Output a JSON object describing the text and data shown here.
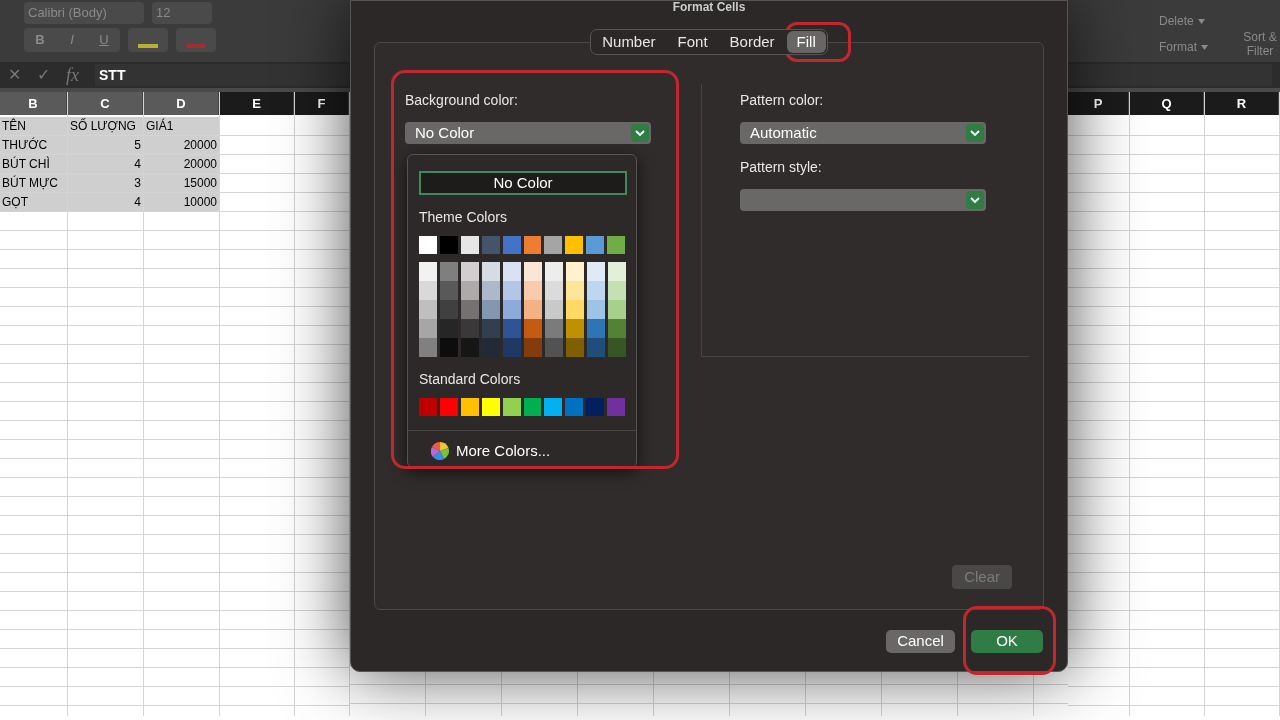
{
  "ribbon": {
    "font_name": "Calibri (Body)",
    "font_size": "12",
    "style_buttons": [
      "B",
      "I",
      "U"
    ],
    "cells_buttons": [
      "Delete",
      "Format"
    ],
    "sort_filter": "Sort & Filter"
  },
  "formula_bar": {
    "cancel": "✕",
    "enter": "✓",
    "fx": "fx",
    "value": "STT"
  },
  "columns_left": [
    {
      "label": "B",
      "selected": true
    },
    {
      "label": "C",
      "selected": true
    },
    {
      "label": "D",
      "selected": true
    },
    {
      "label": "E",
      "selected": false
    },
    {
      "label": "F",
      "selected": false
    }
  ],
  "columns_right": [
    {
      "label": "P",
      "selected": false
    },
    {
      "label": "Q",
      "selected": false
    },
    {
      "label": "R",
      "selected": false
    }
  ],
  "rows": [
    {
      "cells": [
        "TÊN",
        "SỐ LƯỢNG",
        "GIÁ1"
      ]
    },
    {
      "cells": [
        "THƯỚC",
        "5",
        "20000"
      ]
    },
    {
      "cells": [
        "BÚT CHÌ",
        "4",
        "20000"
      ]
    },
    {
      "cells": [
        "BÚT MỰC",
        "3",
        "15000"
      ]
    },
    {
      "cells": [
        "GỌT",
        "4",
        "10000"
      ]
    }
  ],
  "dialog": {
    "title": "Format Cells",
    "tabs": [
      {
        "label": "Number",
        "selected": false
      },
      {
        "label": "Font",
        "selected": false
      },
      {
        "label": "Border",
        "selected": false
      },
      {
        "label": "Fill",
        "selected": true
      }
    ],
    "background_color": {
      "label": "Background color:",
      "value": "No Color",
      "expanded": true
    },
    "pattern_color": {
      "label": "Pattern color:",
      "value": "Automatic"
    },
    "pattern_style": {
      "label": "Pattern style:"
    },
    "popup": {
      "no_color": "No Color",
      "theme_title": "Theme Colors",
      "theme_colors": [
        {
          "color": "#ffffff",
          "shades": [
            {
              "color": "#f2f2f2"
            },
            {
              "color": "#d9d9d9"
            },
            {
              "color": "#bfbfbf"
            },
            {
              "color": "#a6a6a6"
            },
            {
              "color": "#808080"
            }
          ]
        },
        {
          "color": "#000000",
          "shades": [
            {
              "color": "#7f7f7f"
            },
            {
              "color": "#595959"
            },
            {
              "color": "#404040"
            },
            {
              "color": "#262626"
            },
            {
              "color": "#0d0d0d"
            }
          ]
        },
        {
          "color": "#e7e6e6",
          "shades": [
            {
              "color": "#d0cece"
            },
            {
              "color": "#aeaaaa"
            },
            {
              "color": "#757171"
            },
            {
              "color": "#3a3838"
            },
            {
              "color": "#171616"
            }
          ]
        },
        {
          "color": "#44546a",
          "shades": [
            {
              "color": "#d6dce4"
            },
            {
              "color": "#adb9ca"
            },
            {
              "color": "#8497b0"
            },
            {
              "color": "#333f4f"
            },
            {
              "color": "#222a35"
            }
          ]
        },
        {
          "color": "#4472c4",
          "shades": [
            {
              "color": "#d9e2f3"
            },
            {
              "color": "#b4c6e7"
            },
            {
              "color": "#8eaadb"
            },
            {
              "color": "#2f5496"
            },
            {
              "color": "#1f3864"
            }
          ]
        },
        {
          "color": "#ed7d31",
          "shades": [
            {
              "color": "#fbe5d5"
            },
            {
              "color": "#f7cbac"
            },
            {
              "color": "#f4b183"
            },
            {
              "color": "#c55a11"
            },
            {
              "color": "#843c0b"
            }
          ]
        },
        {
          "color": "#a5a5a5",
          "shades": [
            {
              "color": "#ededed"
            },
            {
              "color": "#dbdbdb"
            },
            {
              "color": "#c9c9c9"
            },
            {
              "color": "#7b7b7b"
            },
            {
              "color": "#525252"
            }
          ]
        },
        {
          "color": "#ffc000",
          "shades": [
            {
              "color": "#fff2cc"
            },
            {
              "color": "#ffe599"
            },
            {
              "color": "#ffd966"
            },
            {
              "color": "#bf9000"
            },
            {
              "color": "#7f6000"
            }
          ]
        },
        {
          "color": "#5b9bd5",
          "shades": [
            {
              "color": "#deebf6"
            },
            {
              "color": "#bdd7ee"
            },
            {
              "color": "#9dc3e6"
            },
            {
              "color": "#2e75b5"
            },
            {
              "color": "#1f4e79"
            }
          ]
        },
        {
          "color": "#70ad47",
          "shades": [
            {
              "color": "#e2efd9"
            },
            {
              "color": "#c5e0b3"
            },
            {
              "color": "#a8d08d"
            },
            {
              "color": "#538135"
            },
            {
              "color": "#375623"
            }
          ]
        }
      ],
      "standard_title": "Standard Colors",
      "standard_colors": [
        {
          "color": "#c00000"
        },
        {
          "color": "#ff0000"
        },
        {
          "color": "#ffc000"
        },
        {
          "color": "#ffff00"
        },
        {
          "color": "#92d050"
        },
        {
          "color": "#00b050"
        },
        {
          "color": "#00b0f0"
        },
        {
          "color": "#0070c0"
        },
        {
          "color": "#002060"
        },
        {
          "color": "#7030a0"
        }
      ],
      "more": "More Colors..."
    },
    "clear": {
      "label": "Clear",
      "disabled": true
    },
    "buttons": [
      {
        "label": "Cancel",
        "kind": "secondary"
      },
      {
        "label": "OK",
        "kind": "primary"
      }
    ]
  }
}
